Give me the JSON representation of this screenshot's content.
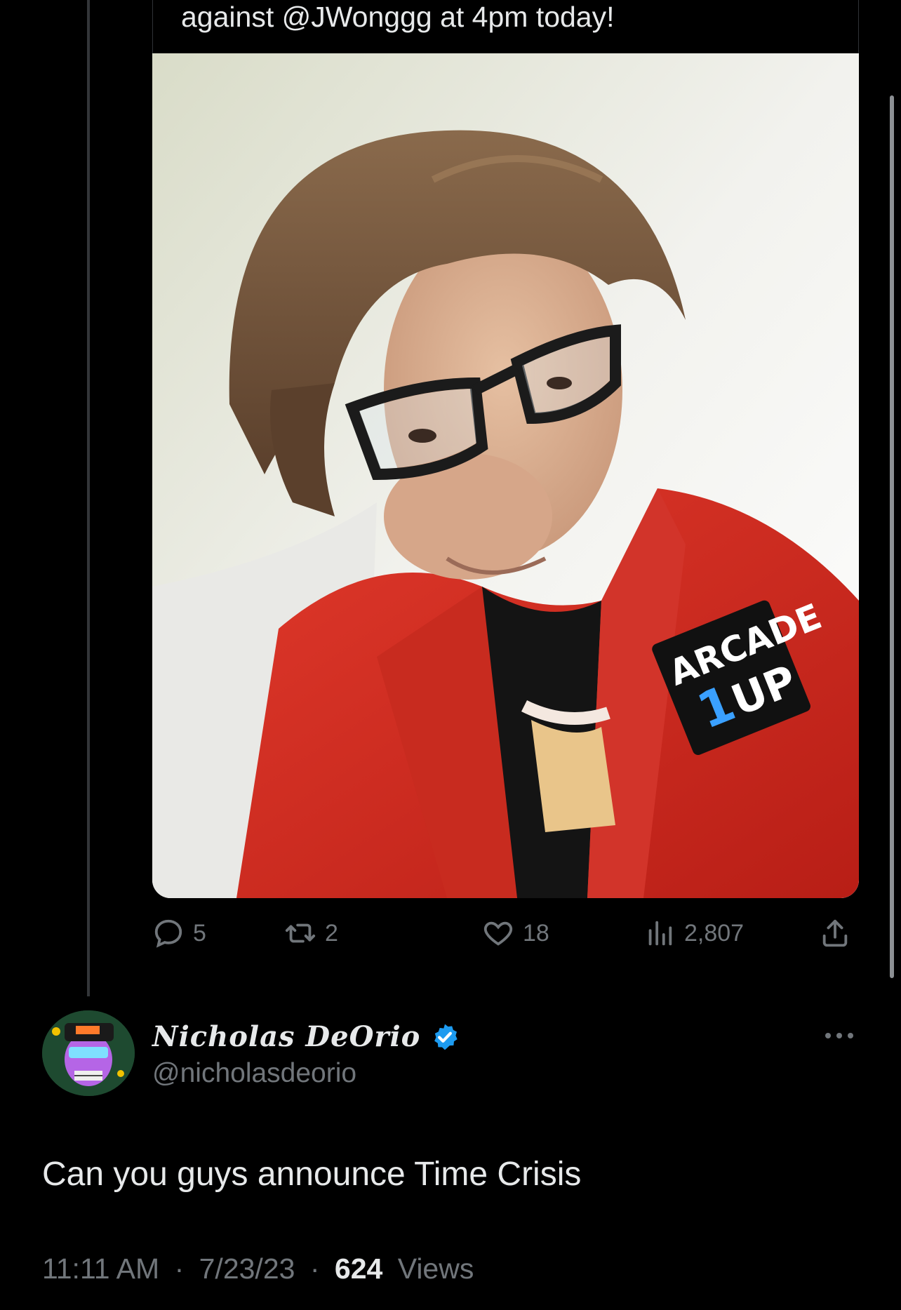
{
  "quoted_tweet": {
    "text_tail": "against @JWonggg at 4pm today!",
    "photo_alt_icon": "photo-selfie"
  },
  "tweet_actions": {
    "replies": "5",
    "retweets": "2",
    "likes": "18",
    "views": "2,807"
  },
  "reply": {
    "display_name": "Nicholas DeOrio",
    "handle": "@nicholasdeorio",
    "verified": true,
    "text": "Can you guys announce Time Crisis",
    "time": "11:11 AM",
    "separator": "·",
    "date": "7/23/23",
    "views_count": "624",
    "views_label": "Views"
  },
  "colors": {
    "background": "#000000",
    "text_primary": "#e7e9ea",
    "text_secondary": "#71767b",
    "verified_blue": "#1d9bf0"
  }
}
